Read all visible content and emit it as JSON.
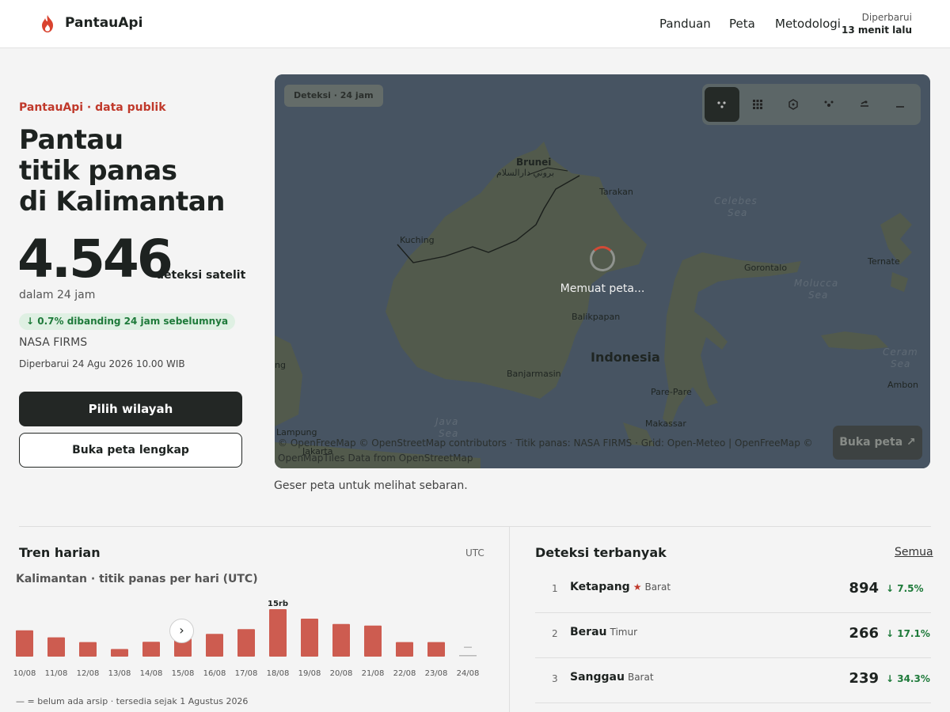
{
  "header": {
    "brand": "PantauApi",
    "nav": [
      "Panduan",
      "Peta",
      "Metodologi"
    ],
    "updated_label": "Diperbarui",
    "updated_value": "13 menit lalu"
  },
  "hero": {
    "eyebrow": "PantauApi · data publik",
    "title_lines": [
      "Pantau",
      "titik panas",
      "di Kalimantan"
    ],
    "count": "4.546",
    "count_unit": "deteksi satelit",
    "within": "dalam 24 jam",
    "change": "↓ 0.7% dibanding 24 jam sebelumnya",
    "separator": "·",
    "source": "NASA FIRMS",
    "updated_at": "Diperbarui 24 Agu 2026 10.00 WIB",
    "primary_button": "Pilih wilayah",
    "secondary_button": "Buka peta lengkap"
  },
  "map": {
    "badge": "Deteksi · 24 jam",
    "loading": "Memuat peta...",
    "open_button": "Buka peta ↗",
    "caption": "Geser peta untuk melihat sebaran.",
    "attribution": "© OpenFreeMap © OpenStreetMap contributors · Titik panas: NASA FIRMS · Grid: Open-Meteo | OpenFreeMap © OpenMapTiles Data from OpenStreetMap",
    "labels": {
      "brunei": "Brunei",
      "brunei_arabic": "بروني دارالسلام",
      "tarakan": "Tarakan",
      "celebes": "Celebes",
      "celebes_sea": "Sea",
      "kuching": "Kuching",
      "gorontalo": "Gorontalo",
      "ternate": "Ternate",
      "molucca": "Molucca",
      "molucca_sea": "Sea",
      "balikpapan": "Balikpapan",
      "indonesia": "Indonesia",
      "banjarmasin": "Banjarmasin",
      "ceram": "Ceram",
      "ceram_sea": "Sea",
      "ambon": "Ambon",
      "parepare": "Pare-Pare",
      "makassar": "Makassar",
      "java": "Java",
      "java_sea": "Sea",
      "lampung": "Lampung",
      "jakarta": "Jakarta",
      "ng": "ng"
    },
    "tools": [
      "points-icon",
      "grid-icon",
      "hexagon-icon",
      "cluster-icon",
      "heat-icon",
      "minus-icon"
    ],
    "active_tool": 0,
    "colors": {
      "land": "#525a4c",
      "sea": "#475462",
      "border": "#1b1f1c",
      "spinner": "#d24a36"
    }
  },
  "trend": {
    "title": "Tren harian",
    "tz": "UTC",
    "subtitle": "Kalimantan · titik panas per hari (UTC)",
    "note": "— = belum ada arsip · tersedia sejak 1 Agustus 2026",
    "scroll_glyph": "›"
  },
  "chart_data": {
    "type": "bar",
    "categories": [
      "10/08",
      "11/08",
      "12/08",
      "13/08",
      "14/08",
      "15/08",
      "16/08",
      "17/08",
      "18/08",
      "19/08",
      "20/08",
      "21/08",
      "22/08",
      "23/08",
      "24/08"
    ],
    "values": [
      8300,
      6100,
      4600,
      2400,
      4700,
      5700,
      7200,
      8700,
      15000,
      12000,
      10300,
      9800,
      4600,
      4600,
      null
    ],
    "missing_marker": "—",
    "peak_label": "15rb",
    "title": "Kalimantan · titik panas per hari (UTC)",
    "ylim": [
      0,
      15000
    ],
    "color": "#cd5c50",
    "missing_color": "#b8b8b8",
    "grid": false,
    "legend": "none"
  },
  "top": {
    "title": "Deteksi terbanyak",
    "all_link": "Semua",
    "items": [
      {
        "rank": "1",
        "name": "Ketapang",
        "starred": true,
        "star": "★",
        "sub": "Barat",
        "count": "894",
        "change": "↓ 7.5%"
      },
      {
        "rank": "2",
        "name": "Berau",
        "starred": false,
        "star": "",
        "sub": "Timur",
        "count": "266",
        "change": "↓ 17.1%"
      },
      {
        "rank": "3",
        "name": "Sanggau",
        "starred": false,
        "star": "",
        "sub": "Barat",
        "count": "239",
        "change": "↓ 34.3%"
      }
    ]
  }
}
